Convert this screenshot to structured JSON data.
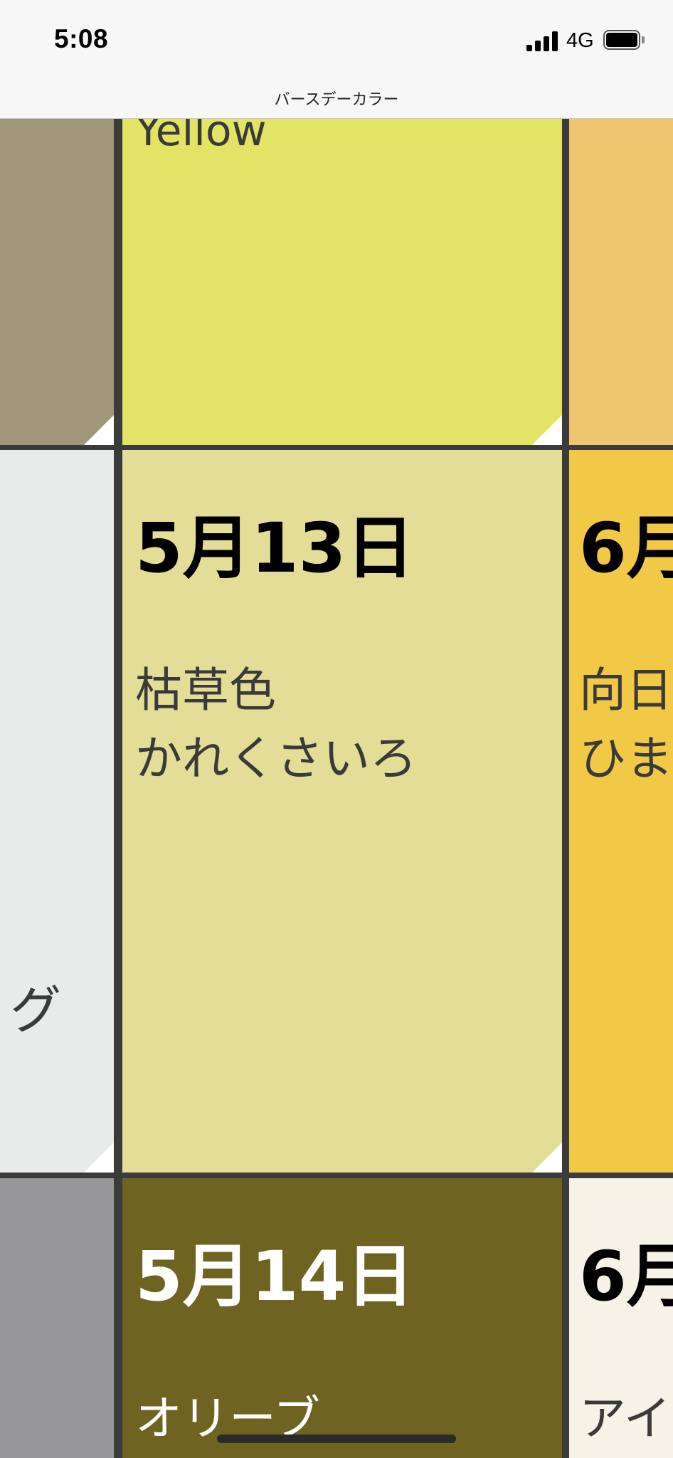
{
  "status_bar": {
    "time": "5:08",
    "network": "4G"
  },
  "nav": {
    "title": "バースデーカラー"
  },
  "cells": {
    "top_middle_partial_label": "Yellow",
    "left_middle_partial_label": "グ",
    "may13": {
      "date": "5月13日",
      "name": "枯草色",
      "reading": "かれくさいろ",
      "bg": "#e3dd97"
    },
    "may14": {
      "date": "5月14日",
      "name_partial": "オリーブ",
      "bg": "#6f6322"
    },
    "right_mid": {
      "date_partial": "6月",
      "name_partial": "向日",
      "reading_partial": "ひま",
      "bg": "#f1c946"
    },
    "right_bottom": {
      "date_partial": "6月",
      "name_partial": "アイ",
      "bg": "#f6f2e7"
    }
  },
  "colors": {
    "top_left": "#a09679",
    "top_middle": "#e3e465",
    "top_right": "#efc56f",
    "mid_left": "#e9ebea",
    "bottom_left": "#97979a",
    "grid_line": "#3b3b3b"
  }
}
